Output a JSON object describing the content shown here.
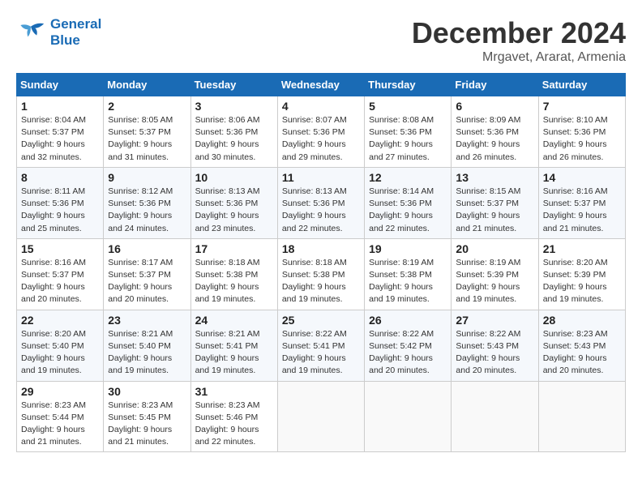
{
  "header": {
    "logo_line1": "General",
    "logo_line2": "Blue",
    "month": "December 2024",
    "location": "Mrgavet, Ararat, Armenia"
  },
  "weekdays": [
    "Sunday",
    "Monday",
    "Tuesday",
    "Wednesday",
    "Thursday",
    "Friday",
    "Saturday"
  ],
  "weeks": [
    [
      {
        "day": "1",
        "sunrise": "8:04 AM",
        "sunset": "5:37 PM",
        "daylight": "9 hours and 32 minutes."
      },
      {
        "day": "2",
        "sunrise": "8:05 AM",
        "sunset": "5:37 PM",
        "daylight": "9 hours and 31 minutes."
      },
      {
        "day": "3",
        "sunrise": "8:06 AM",
        "sunset": "5:36 PM",
        "daylight": "9 hours and 30 minutes."
      },
      {
        "day": "4",
        "sunrise": "8:07 AM",
        "sunset": "5:36 PM",
        "daylight": "9 hours and 29 minutes."
      },
      {
        "day": "5",
        "sunrise": "8:08 AM",
        "sunset": "5:36 PM",
        "daylight": "9 hours and 27 minutes."
      },
      {
        "day": "6",
        "sunrise": "8:09 AM",
        "sunset": "5:36 PM",
        "daylight": "9 hours and 26 minutes."
      },
      {
        "day": "7",
        "sunrise": "8:10 AM",
        "sunset": "5:36 PM",
        "daylight": "9 hours and 26 minutes."
      }
    ],
    [
      {
        "day": "8",
        "sunrise": "8:11 AM",
        "sunset": "5:36 PM",
        "daylight": "9 hours and 25 minutes."
      },
      {
        "day": "9",
        "sunrise": "8:12 AM",
        "sunset": "5:36 PM",
        "daylight": "9 hours and 24 minutes."
      },
      {
        "day": "10",
        "sunrise": "8:13 AM",
        "sunset": "5:36 PM",
        "daylight": "9 hours and 23 minutes."
      },
      {
        "day": "11",
        "sunrise": "8:13 AM",
        "sunset": "5:36 PM",
        "daylight": "9 hours and 22 minutes."
      },
      {
        "day": "12",
        "sunrise": "8:14 AM",
        "sunset": "5:36 PM",
        "daylight": "9 hours and 22 minutes."
      },
      {
        "day": "13",
        "sunrise": "8:15 AM",
        "sunset": "5:37 PM",
        "daylight": "9 hours and 21 minutes."
      },
      {
        "day": "14",
        "sunrise": "8:16 AM",
        "sunset": "5:37 PM",
        "daylight": "9 hours and 21 minutes."
      }
    ],
    [
      {
        "day": "15",
        "sunrise": "8:16 AM",
        "sunset": "5:37 PM",
        "daylight": "9 hours and 20 minutes."
      },
      {
        "day": "16",
        "sunrise": "8:17 AM",
        "sunset": "5:37 PM",
        "daylight": "9 hours and 20 minutes."
      },
      {
        "day": "17",
        "sunrise": "8:18 AM",
        "sunset": "5:38 PM",
        "daylight": "9 hours and 19 minutes."
      },
      {
        "day": "18",
        "sunrise": "8:18 AM",
        "sunset": "5:38 PM",
        "daylight": "9 hours and 19 minutes."
      },
      {
        "day": "19",
        "sunrise": "8:19 AM",
        "sunset": "5:38 PM",
        "daylight": "9 hours and 19 minutes."
      },
      {
        "day": "20",
        "sunrise": "8:19 AM",
        "sunset": "5:39 PM",
        "daylight": "9 hours and 19 minutes."
      },
      {
        "day": "21",
        "sunrise": "8:20 AM",
        "sunset": "5:39 PM",
        "daylight": "9 hours and 19 minutes."
      }
    ],
    [
      {
        "day": "22",
        "sunrise": "8:20 AM",
        "sunset": "5:40 PM",
        "daylight": "9 hours and 19 minutes."
      },
      {
        "day": "23",
        "sunrise": "8:21 AM",
        "sunset": "5:40 PM",
        "daylight": "9 hours and 19 minutes."
      },
      {
        "day": "24",
        "sunrise": "8:21 AM",
        "sunset": "5:41 PM",
        "daylight": "9 hours and 19 minutes."
      },
      {
        "day": "25",
        "sunrise": "8:22 AM",
        "sunset": "5:41 PM",
        "daylight": "9 hours and 19 minutes."
      },
      {
        "day": "26",
        "sunrise": "8:22 AM",
        "sunset": "5:42 PM",
        "daylight": "9 hours and 20 minutes."
      },
      {
        "day": "27",
        "sunrise": "8:22 AM",
        "sunset": "5:43 PM",
        "daylight": "9 hours and 20 minutes."
      },
      {
        "day": "28",
        "sunrise": "8:23 AM",
        "sunset": "5:43 PM",
        "daylight": "9 hours and 20 minutes."
      }
    ],
    [
      {
        "day": "29",
        "sunrise": "8:23 AM",
        "sunset": "5:44 PM",
        "daylight": "9 hours and 21 minutes."
      },
      {
        "day": "30",
        "sunrise": "8:23 AM",
        "sunset": "5:45 PM",
        "daylight": "9 hours and 21 minutes."
      },
      {
        "day": "31",
        "sunrise": "8:23 AM",
        "sunset": "5:46 PM",
        "daylight": "9 hours and 22 minutes."
      },
      null,
      null,
      null,
      null
    ]
  ],
  "labels": {
    "sunrise": "Sunrise:",
    "sunset": "Sunset:",
    "daylight": "Daylight:"
  }
}
